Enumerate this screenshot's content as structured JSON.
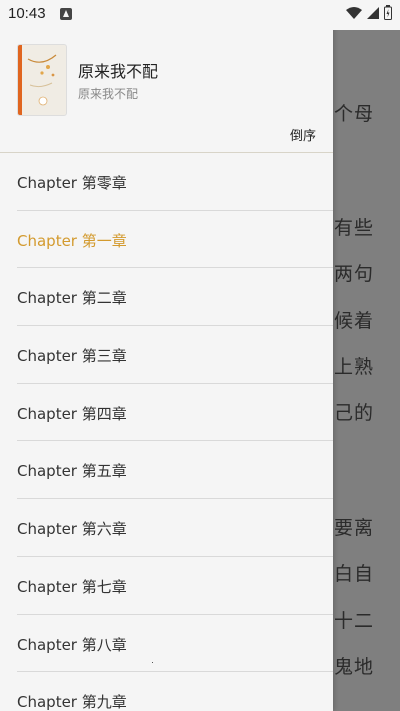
{
  "status_bar": {
    "time": "10:43"
  },
  "book": {
    "title": "原来我不配",
    "author": "原来我不配"
  },
  "sort_label": "倒序",
  "chapters": [
    {
      "label": "Chapter 第零章",
      "active": false
    },
    {
      "label": "Chapter 第一章",
      "active": true
    },
    {
      "label": "Chapter 第二章",
      "active": false
    },
    {
      "label": "Chapter 第三章",
      "active": false
    },
    {
      "label": "Chapter 第四章",
      "active": false
    },
    {
      "label": "Chapter 第五章",
      "active": false
    },
    {
      "label": "Chapter 第六章",
      "active": false
    },
    {
      "label": "Chapter 第七章",
      "active": false
    },
    {
      "label": "Chapter 第八章",
      "active": false
    },
    {
      "label": "Chapter 第九章",
      "active": false
    }
  ],
  "reader_lines": [
    "个母",
    "有些",
    "两句",
    "候着",
    "上熟",
    "己的",
    "要离",
    "白自",
    "十二",
    "鬼地"
  ],
  "colors": {
    "active_chapter": "#d39a2e",
    "drawer_bg": "#f5f5f5",
    "overlay": "#7f7f7f",
    "cover_spine": "#e0651f"
  },
  "icons": [
    "wifi-icon",
    "signal-icon",
    "battery-icon",
    "notification-icon"
  ]
}
